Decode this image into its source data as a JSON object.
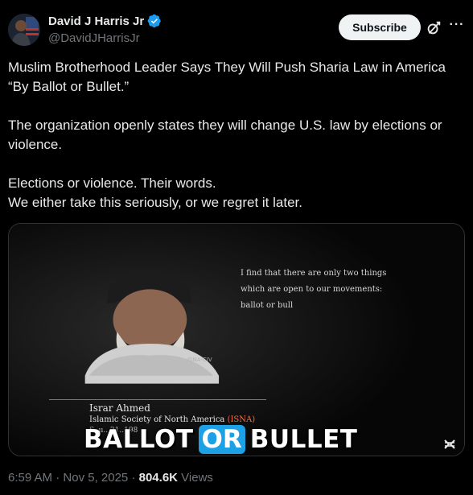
{
  "author": {
    "display_name": "David J Harris Jr",
    "handle": "@DavidJHarrisJr",
    "verified": true,
    "avatar_icon": "avatar-photo"
  },
  "header": {
    "subscribe_label": "Subscribe",
    "grok_icon": "grok-icon",
    "more_icon": "more-icon",
    "more_label": "···"
  },
  "tweet": {
    "lines": [
      "Muslim Brotherhood Leader Says They Will Push Sharia Law in America",
      "“By Ballot or Bullet.”",
      "The organization openly states they will change U.S. law by elections or violence.",
      "Elections or violence. Their words.",
      "We either take this seriously, or we regret it later."
    ]
  },
  "media": {
    "quote_lines": [
      "I find that there are only two things",
      "which are open to our movements:",
      "ballot or bull"
    ],
    "watermark": "ISNA-CIV",
    "speaker_name": "Israr Ahmed",
    "speaker_org": "Islamic Society of North America",
    "speaker_org_abbr": "(ISNA)",
    "speaker_date": "S..u.. 21..198",
    "caption": {
      "word1": "BALLOT",
      "word2": "OR",
      "word3": "BULLET"
    },
    "caption_highlight_color": "#1da1e6",
    "cc_icon": "captions-toggle-icon"
  },
  "meta": {
    "time": "6:59 AM",
    "sep1": " · ",
    "date": "Nov 5, 2025",
    "sep2": " · ",
    "views_count": "804.6K",
    "views_label": " Views"
  },
  "colors": {
    "background": "#000000",
    "text": "#e7e9ea",
    "muted": "#71767b",
    "verified": "#1d9bf0"
  }
}
